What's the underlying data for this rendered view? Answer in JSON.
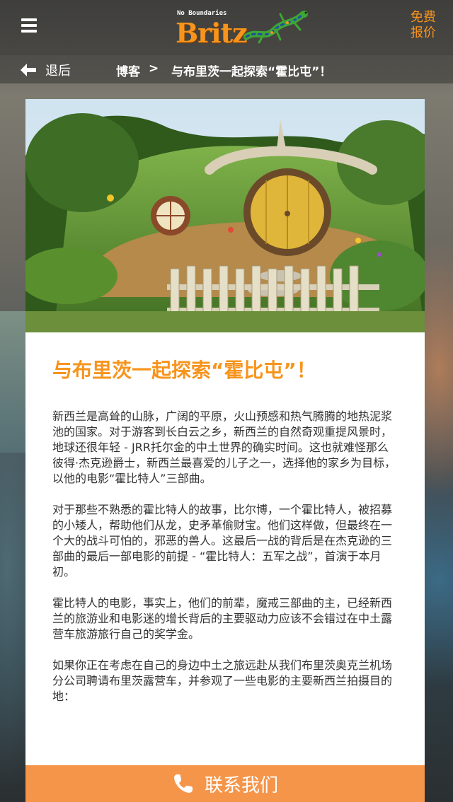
{
  "header": {
    "menu_icon": "hamburger-menu-icon",
    "logo_tagline": "No Boundaries",
    "logo_text": "Britz",
    "quote_line1": "免费",
    "quote_line2": "报价",
    "accent_color": "#f7941d"
  },
  "breadcrumb": {
    "back_icon": "arrow-left-icon",
    "back_label": "退后",
    "blog_label": "博客",
    "separator": ">",
    "current": "与布里茨一起探索“霍比屯”！"
  },
  "article": {
    "title": "与布里茨一起探索“霍比屯”！",
    "paragraphs": [
      "新西兰是高耸的山脉，广阔的平原，火山预感和热气腾腾的地热泥浆池的国家。对于游客到长白云之乡，新西兰的自然奇观重提风景时，地球还很年轻 - JRR托尔金的中土世界的确实时间。这也就难怪那么彼得·杰克逊爵士，新西兰最喜爱的儿子之一，选择他的家乡为目标，以他的电影“霍比特人”三部曲。",
      "对于那些不熟悉的霍比特人的故事，比尔博，一个霍比特人，被招募的小矮人，帮助他们从龙，史矛革偷财宝。他们这样做，但最终在一个大的战斗可怕的，邪恶的兽人。这最后一战的背后是在杰克逊的三部曲的最后一部电影的前提 - “霍比特人：五军之战”，首演于本月初。",
      "霍比特人的电影，事实上，他们的前辈，魔戒三部曲的主，已经新西兰的旅游业和电影迷的增长背后的主要驱动力应该不会错过在中土露营车旅游旅行自己的奖学金。",
      "如果你正在考虑在自己的身边中土之旅远赴从我们布里茨奥克兰机场分公司聘请布里茨露营车，并参观了一些电影的主要新西兰拍摄目的地："
    ]
  },
  "contact": {
    "icon": "phone-icon",
    "label": "联系我们",
    "color": "#f5954a"
  }
}
